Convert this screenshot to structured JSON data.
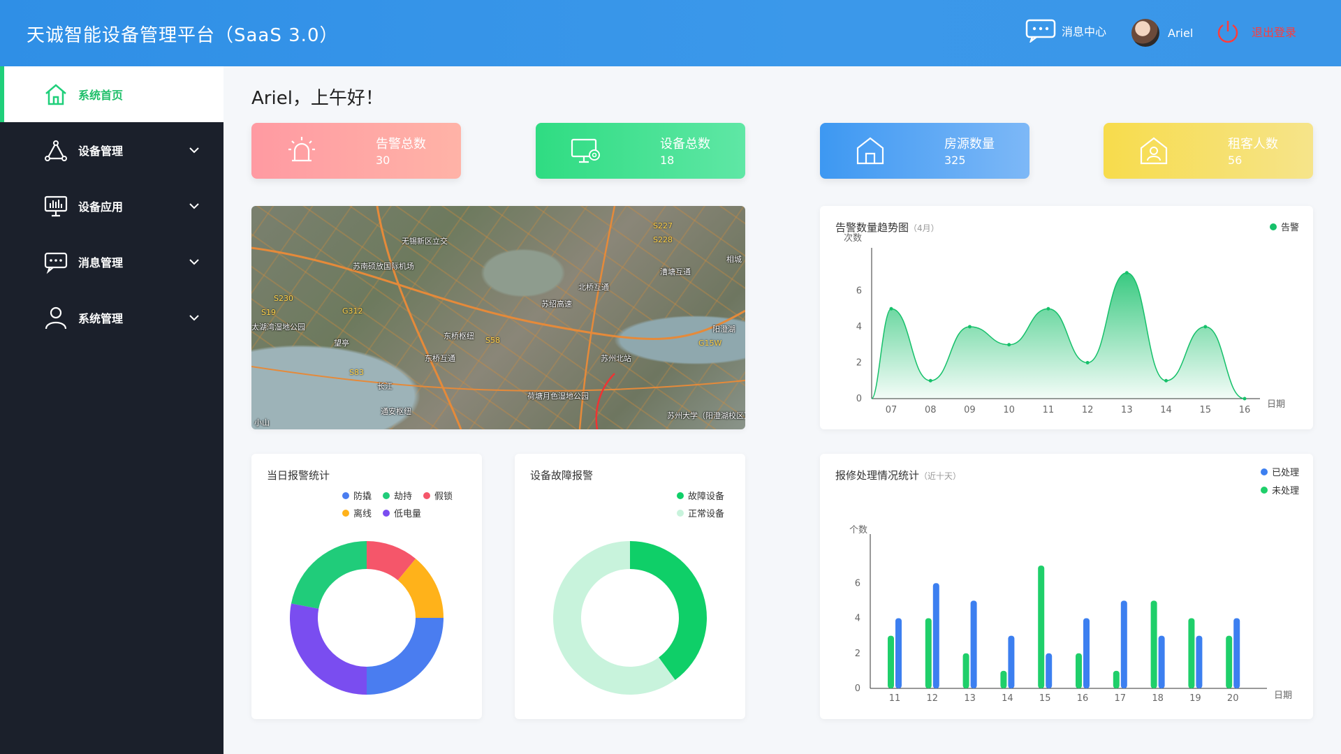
{
  "header": {
    "title": "天诚智能设备管理平台（SaaS 3.0）",
    "message_center": "消息中心",
    "username": "Ariel",
    "logout": "退出登录"
  },
  "sidebar": {
    "items": [
      {
        "label": "系统首页",
        "icon": "home-icon",
        "active": true
      },
      {
        "label": "设备管理",
        "icon": "device-manage-icon"
      },
      {
        "label": "设备应用",
        "icon": "monitor-icon"
      },
      {
        "label": "消息管理",
        "icon": "message-icon"
      },
      {
        "label": "系统管理",
        "icon": "user-icon"
      }
    ]
  },
  "greeting": "Ariel，上午好！",
  "stats": [
    {
      "label": "告警总数",
      "value": "30",
      "color": "#ff9aa2",
      "icon": "alarm-light-icon"
    },
    {
      "label": "设备总数",
      "value": "18",
      "color": "#2fdc82",
      "icon": "computer-gear-icon"
    },
    {
      "label": "房源数量",
      "value": "325",
      "color": "#3d98f2",
      "icon": "house-icon"
    },
    {
      "label": "租客人数",
      "value": "56",
      "color": "#f7dc4c",
      "icon": "house-person-icon"
    }
  ],
  "map": {
    "labels": [
      "无锡新区立交",
      "苏南硕放国际机场",
      "北桥互通",
      "漕塘互通",
      "相城",
      "苏绍高速",
      "东桥枢纽",
      "东桥互通",
      "苏州北站",
      "荷塘月色湿地公园",
      "苏州大学（阳澄湖校区）",
      "望亭",
      "通安枢纽",
      "长江",
      "小山",
      "太湖湾湿地公园",
      "阳澄湖"
    ],
    "roads": [
      "S19",
      "G312",
      "S58",
      "G15W",
      "S83",
      "S230",
      "S227",
      "S228"
    ]
  },
  "chart_data": [
    {
      "type": "area",
      "title": "告警数量趋势图",
      "subtitle": "（4月）",
      "ylabel": "次数",
      "xlabel": "日期",
      "categories": [
        "07",
        "08",
        "09",
        "10",
        "11",
        "12",
        "13",
        "14",
        "15",
        "16"
      ],
      "series": [
        {
          "name": "告警",
          "color": "#16c06a",
          "values": [
            5,
            1,
            4,
            3,
            5,
            2,
            7,
            1,
            4,
            0
          ]
        }
      ],
      "ylim": [
        0,
        8
      ],
      "yticks": [
        0,
        2,
        4,
        6
      ],
      "legend": "top-right"
    },
    {
      "type": "pie",
      "title": "当日报警统计",
      "labels": [
        "防撬",
        "劫持",
        "假锁",
        "离线",
        "低电量"
      ],
      "colors": [
        "#4a7df0",
        "#20cc7a",
        "#f5566a",
        "#ffb21a",
        "#7a4df0"
      ],
      "values": [
        25,
        22,
        11,
        14,
        28
      ],
      "legend": "top-right"
    },
    {
      "type": "pie",
      "title": "设备故障报警",
      "labels": [
        "故障设备",
        "正常设备"
      ],
      "colors": [
        "#0fcf68",
        "#c8f3dc"
      ],
      "values": [
        40,
        60
      ],
      "legend": "top-right"
    },
    {
      "type": "bar",
      "title": "报修处理情况统计",
      "subtitle": "（近十天）",
      "ylabel": "个数",
      "xlabel": "日期",
      "categories": [
        "11",
        "12",
        "13",
        "14",
        "15",
        "16",
        "17",
        "18",
        "19",
        "20"
      ],
      "series": [
        {
          "name": "已处理",
          "color": "#3c7ff0",
          "values": [
            4,
            6,
            5,
            3,
            2,
            4,
            5,
            3,
            3,
            4
          ]
        },
        {
          "name": "未处理",
          "color": "#1fcf6a",
          "values": [
            3,
            4,
            2,
            1,
            7,
            2,
            1,
            5,
            4,
            3
          ]
        }
      ],
      "ylim": [
        0,
        8
      ],
      "yticks": [
        0,
        2,
        4,
        6
      ],
      "legend": "top-right"
    }
  ]
}
